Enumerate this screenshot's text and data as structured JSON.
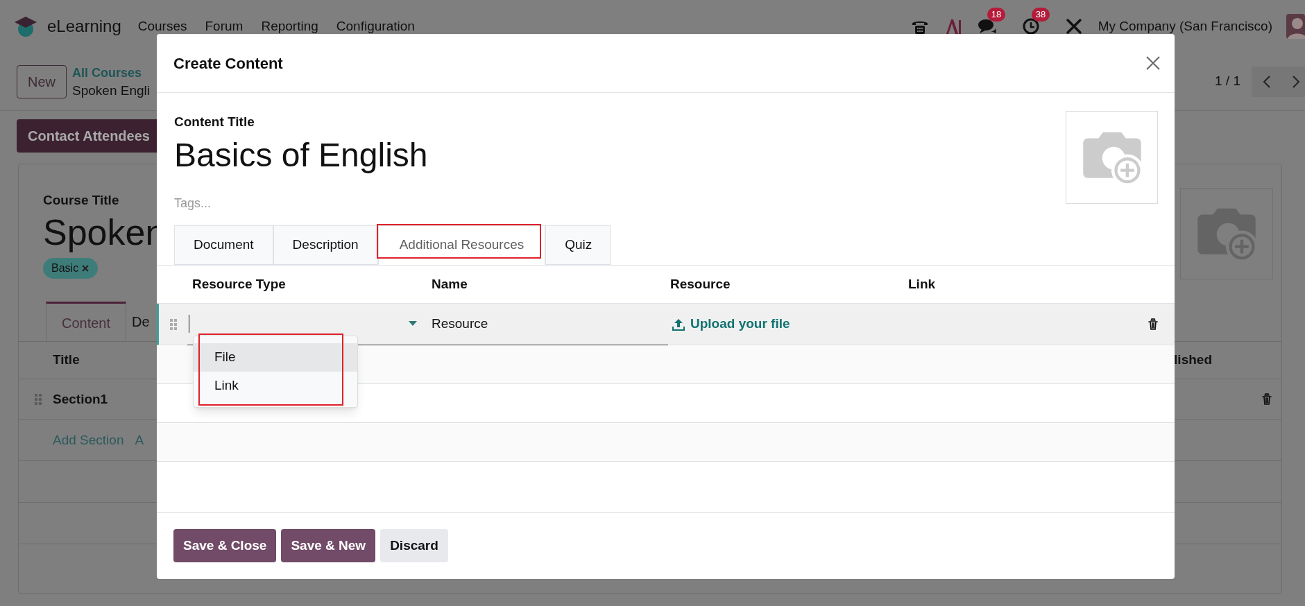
{
  "navbar": {
    "app_name": "eLearning",
    "menu": [
      "Courses",
      "Forum",
      "Reporting",
      "Configuration"
    ],
    "systray": [
      {
        "kind": "phone"
      },
      {
        "kind": "assistant"
      },
      {
        "kind": "chat",
        "count": "18"
      },
      {
        "kind": "activity",
        "count": "38"
      },
      {
        "kind": "tools"
      }
    ],
    "company": "My Company (San Francisco)"
  },
  "control_panel": {
    "new_button": "New",
    "breadcrumb": "All Courses",
    "record": "Spoken Engli",
    "pager": "1 / 1"
  },
  "course_form": {
    "action_button": "Contact Attendees",
    "title_label": "Course Title",
    "title": "Spoken",
    "tags": [
      "Basic"
    ],
    "tabs": [
      {
        "label": "Content",
        "selected": true
      },
      {
        "label": "De",
        "selected": false
      }
    ],
    "columns": [
      "Title",
      "lished"
    ],
    "rows": [
      {
        "title": "Section1"
      }
    ],
    "add_links": [
      "Add Section",
      "A"
    ]
  },
  "dialog": {
    "title": "Create Content",
    "field_label": "Content Title",
    "content_title": "Basics of English",
    "tags_placeholder": "Tags...",
    "tabs": [
      {
        "label": "Document",
        "selected": false
      },
      {
        "label": "Description",
        "selected": false
      },
      {
        "label": "Additional Resources",
        "selected": true
      },
      {
        "label": "Quiz",
        "selected": false
      }
    ],
    "columns": [
      "Resource Type",
      "Name",
      "Resource",
      "Link"
    ],
    "rows": [
      {
        "name": "Resource",
        "upload_link": "Upload your file"
      }
    ],
    "dropdown": [
      {
        "label": "File",
        "selected": true
      },
      {
        "label": "Link",
        "selected": false
      }
    ],
    "buttons": [
      {
        "label": "Save & Close",
        "kind": "primary"
      },
      {
        "label": "Save & New",
        "kind": "primary"
      },
      {
        "label": "Discard",
        "kind": "secondary"
      }
    ]
  }
}
